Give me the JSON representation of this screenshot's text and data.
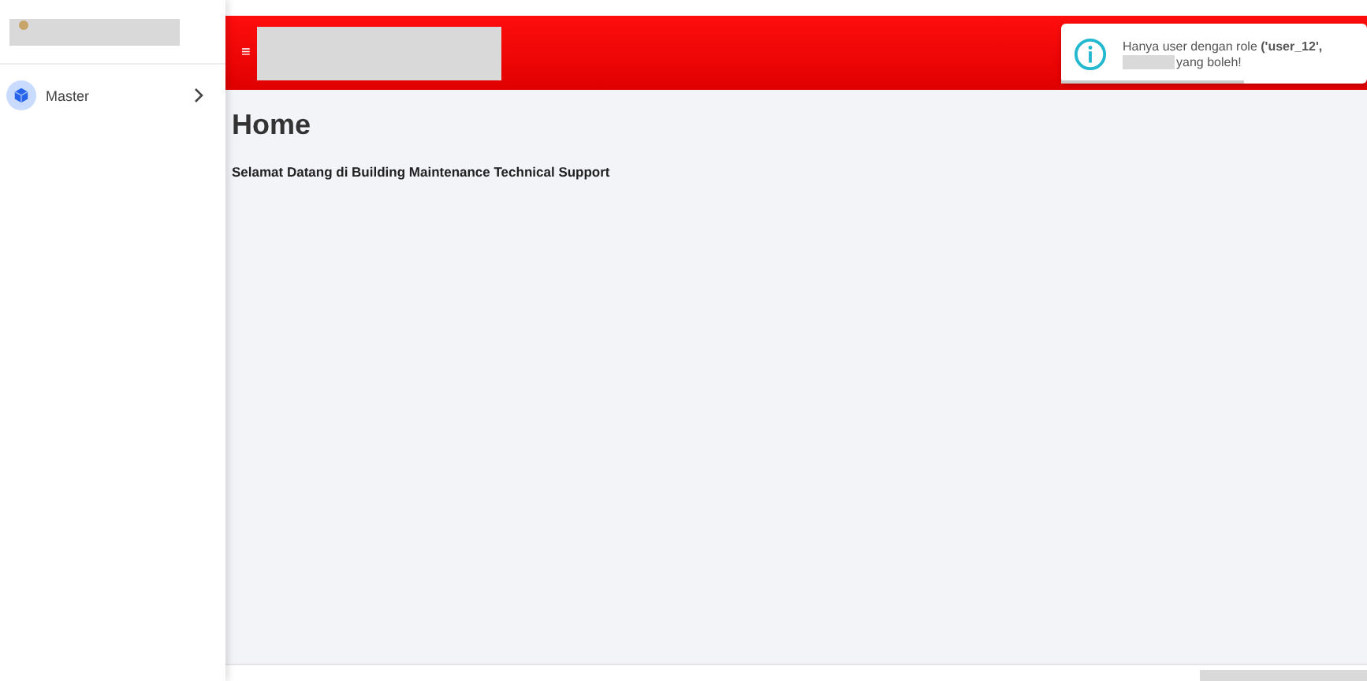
{
  "sidebar": {
    "items": [
      {
        "label": "Master",
        "expanded": false
      }
    ]
  },
  "header": {
    "menu_glyph": "≡"
  },
  "page": {
    "title": "Home",
    "welcome": "Selamat Datang di Building Maintenance Technical Support"
  },
  "toast": {
    "line_1": "Hanya user dengan role **('user_12',**",
    "line_2": "yang boleh!",
    "level": 0.6
  }
}
